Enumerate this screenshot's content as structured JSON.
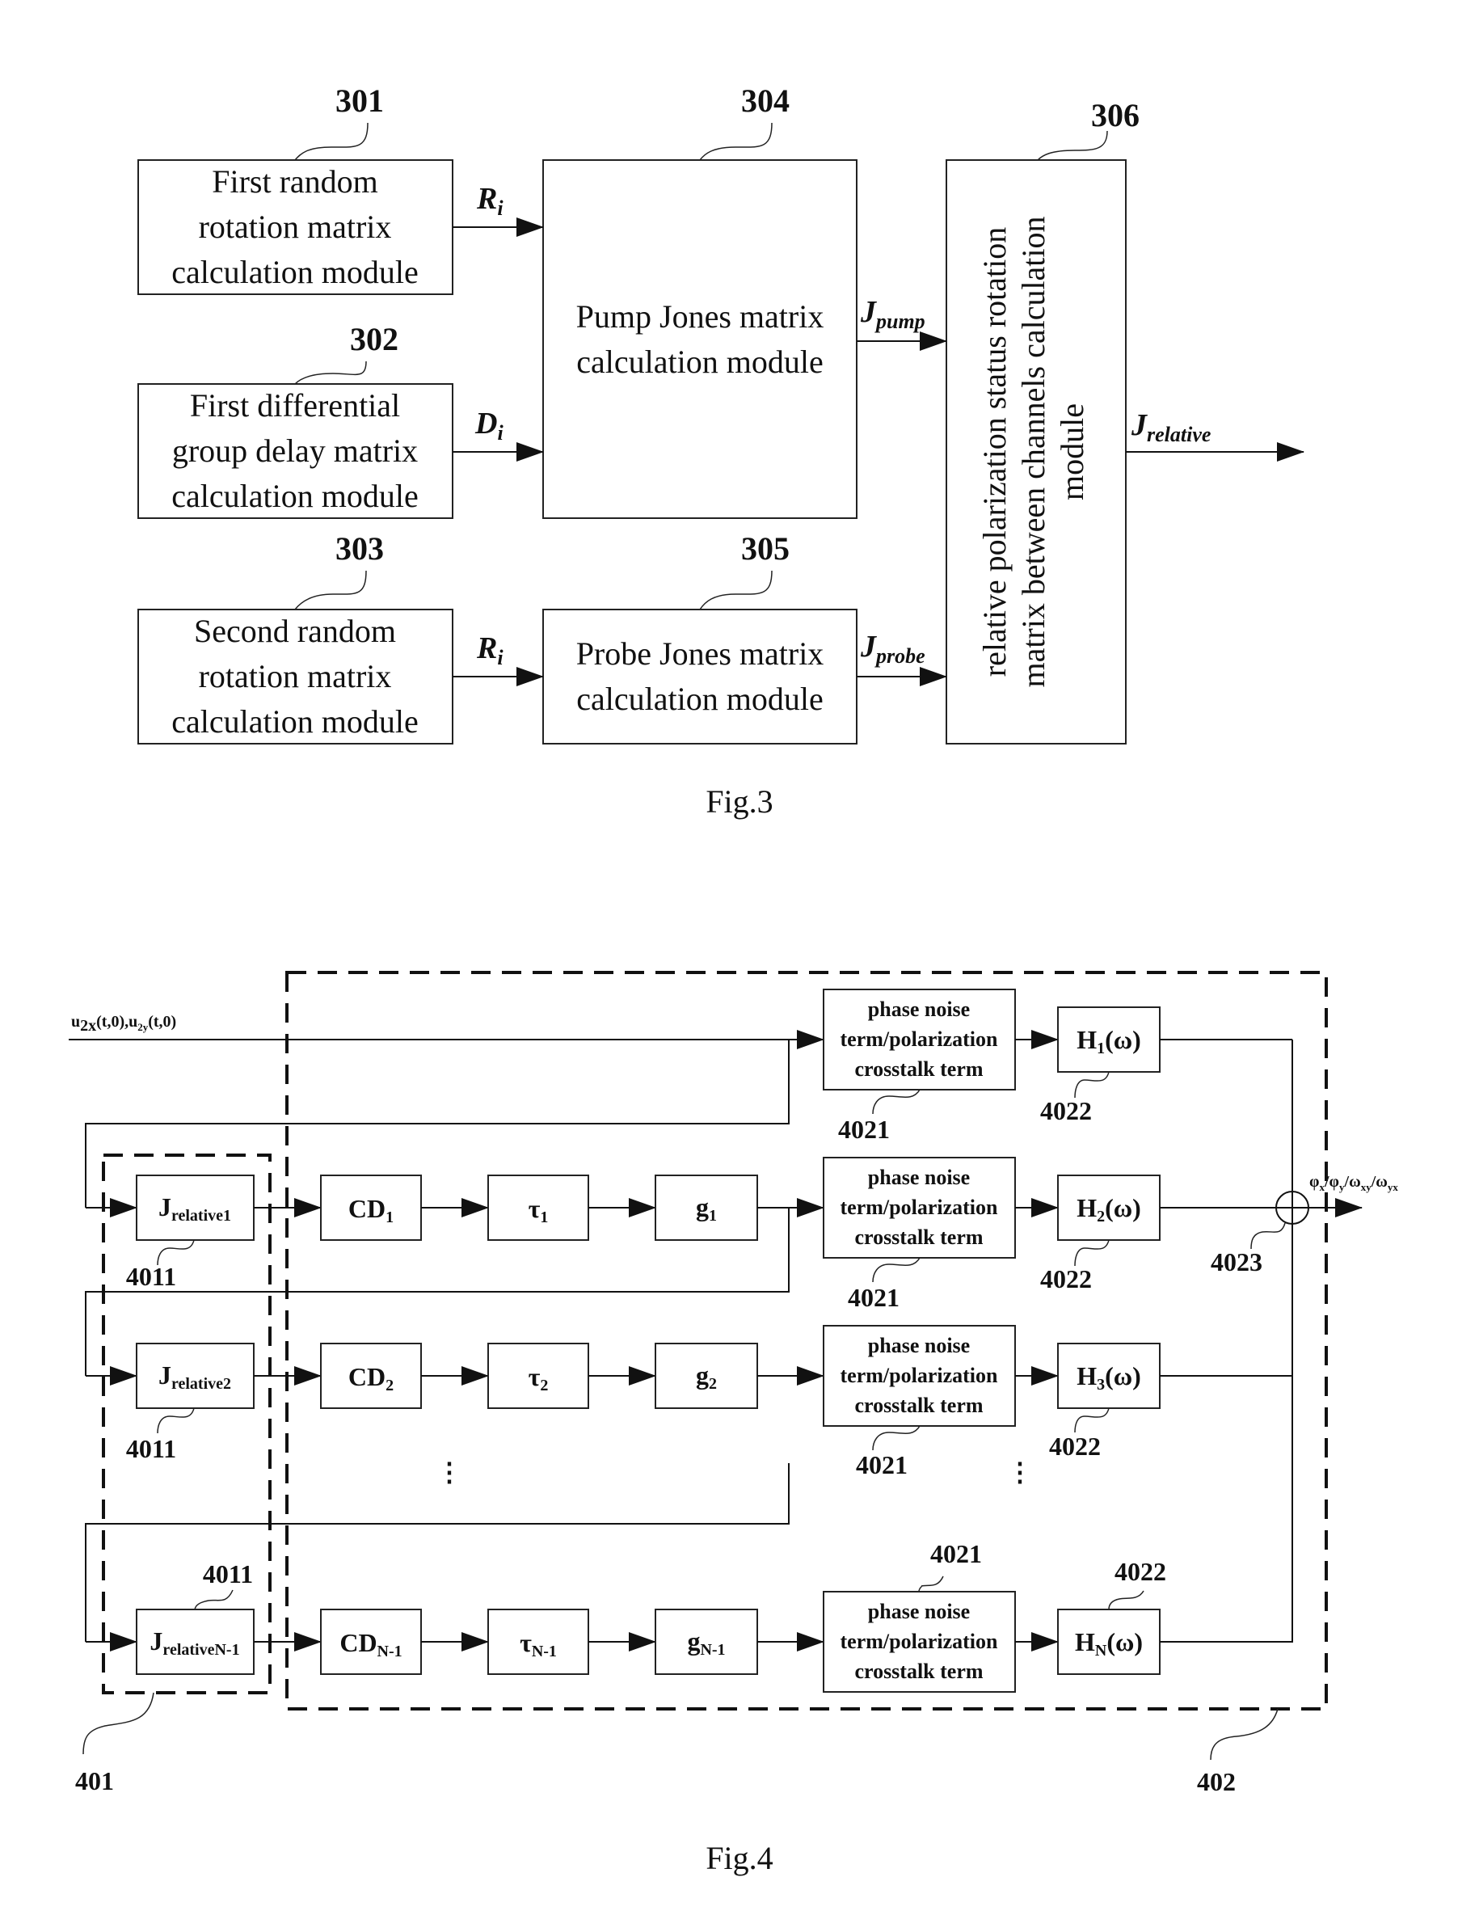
{
  "fig3": {
    "caption": "Fig.3",
    "modules": [
      {
        "ref": "301",
        "lines": [
          "First random",
          "rotation matrix",
          "calculation module"
        ]
      },
      {
        "ref": "302",
        "lines": [
          "First differential",
          "group delay matrix",
          "calculation module"
        ]
      },
      {
        "ref": "303",
        "lines": [
          "Second random",
          "rotation matrix",
          "calculation module"
        ]
      },
      {
        "ref": "304",
        "lines": [
          "Pump Jones matrix",
          "calculation module"
        ]
      },
      {
        "ref": "305",
        "lines": [
          "Probe Jones matrix",
          "calculation module"
        ]
      },
      {
        "ref": "306",
        "lines": [
          "relative polarization status rotation",
          "matrix between channels calculation",
          "module"
        ]
      }
    ],
    "signals": {
      "r1": {
        "main": "R",
        "sub": "i"
      },
      "d": {
        "main": "D",
        "sub": "i"
      },
      "r2": {
        "main": "R",
        "sub": "i"
      },
      "pump": {
        "main": "J",
        "sub": "pump"
      },
      "probe": {
        "main": "J",
        "sub": "probe"
      },
      "relative": {
        "main": "J",
        "sub": "relative"
      }
    }
  },
  "fig4": {
    "caption": "Fig.4",
    "input": {
      "u1": "u",
      "s1": "2x",
      "mid": "(t,0),u",
      "s2": "2y",
      "end": "(t,0)"
    },
    "output": {
      "p1": "φ",
      "s1": "x",
      "p2": "/φ",
      "s2": "y",
      "p3": "/ω",
      "s3": "xy",
      "p4": "/ω",
      "s4": "yx"
    },
    "refs": {
      "group401": "401",
      "group402": "402",
      "jrel": "4011",
      "phase": "4021",
      "filter": "4022",
      "sum": "4023"
    },
    "phase_box_lines": [
      "phase noise",
      "term/polarization",
      "crosstalk term"
    ],
    "rows": [
      {
        "jrel_sub": "relative1",
        "cd_sub": "1",
        "tau_sub": "1",
        "g_sub": "1"
      },
      {
        "jrel_sub": "relative2",
        "cd_sub": "2",
        "tau_sub": "2",
        "g_sub": "2"
      },
      {
        "jrel_sub": "relativeN-1",
        "cd_sub": "N-1",
        "tau_sub": "N-1",
        "g_sub": "N-1"
      }
    ],
    "symbols": {
      "j": "J",
      "cd": "CD",
      "tau": "τ",
      "g": "g",
      "h": "H",
      "omega": "(ω)",
      "ellipsis": "⋮"
    },
    "filters": [
      {
        "sub": "1"
      },
      {
        "sub": "2"
      },
      {
        "sub": "3"
      },
      {
        "sub": "N"
      }
    ]
  }
}
